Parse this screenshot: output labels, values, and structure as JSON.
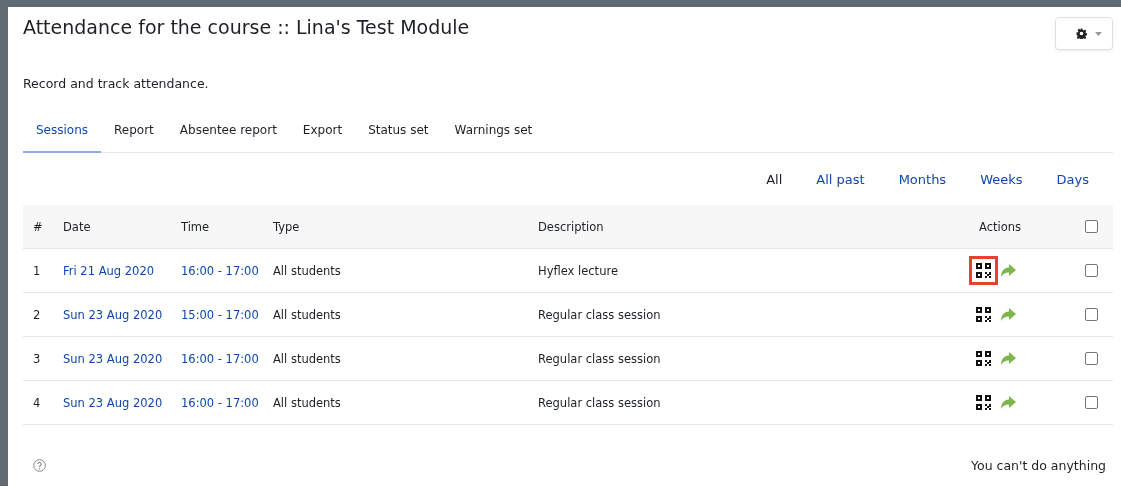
{
  "page": {
    "title": "Attendance for the course :: Lina's Test Module",
    "description": "Record and track attendance."
  },
  "tabs": [
    {
      "label": "Sessions",
      "selected": true
    },
    {
      "label": "Report",
      "selected": false
    },
    {
      "label": "Absentee report",
      "selected": false
    },
    {
      "label": "Export",
      "selected": false
    },
    {
      "label": "Status set",
      "selected": false
    },
    {
      "label": "Warnings set",
      "selected": false
    }
  ],
  "filters": [
    {
      "label": "All",
      "selected": true
    },
    {
      "label": "All past",
      "selected": false
    },
    {
      "label": "Months",
      "selected": false
    },
    {
      "label": "Weeks",
      "selected": false
    },
    {
      "label": "Days",
      "selected": false
    }
  ],
  "table": {
    "columns": [
      "#",
      "Date",
      "Time",
      "Type",
      "Description",
      "Actions"
    ],
    "select_all_checked": false,
    "rows": [
      {
        "number": "1",
        "date": "Fri 21 Aug 2020",
        "time": "16:00 - 17:00",
        "type": "All students",
        "description": "Hyflex lecture",
        "qr_highlighted": true,
        "checked": false
      },
      {
        "number": "2",
        "date": "Sun 23 Aug 2020",
        "time": "15:00 - 17:00",
        "type": "All students",
        "description": "Regular class session",
        "qr_highlighted": false,
        "checked": false
      },
      {
        "number": "3",
        "date": "Sun 23 Aug 2020",
        "time": "16:00 - 17:00",
        "type": "All students",
        "description": "Regular class session",
        "qr_highlighted": false,
        "checked": false
      },
      {
        "number": "4",
        "date": "Sun 23 Aug 2020",
        "time": "16:00 - 17:00",
        "type": "All students",
        "description": "Regular class session",
        "qr_highlighted": false,
        "checked": false
      }
    ]
  },
  "footer": {
    "message": "You can't do anything"
  }
}
